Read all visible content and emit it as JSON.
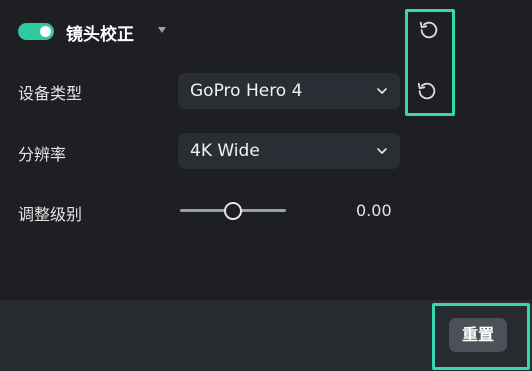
{
  "section": {
    "title": "镜头校正",
    "enabled": true,
    "toggle_icon": "toggle-on",
    "caret_icon": "caret-down"
  },
  "rows": {
    "device_type": {
      "label": "设备类型",
      "value": "GoPro Hero 4"
    },
    "resolution": {
      "label": "分辨率",
      "value": "4K Wide"
    },
    "adjust_level": {
      "label": "调整级别",
      "value": "0.00",
      "slider_fraction": 0.5
    }
  },
  "icons": {
    "reset": "undo-icon",
    "dropdown": "chevron-down-icon"
  },
  "footer": {
    "reset_label": "重置"
  },
  "colors": {
    "accent": "#31c7a0",
    "highlight": "#34d7b0",
    "background": "#1d1f23",
    "footer_bg": "#272a2f",
    "select_bg": "#2a2d33",
    "button_bg": "#4a5159"
  }
}
